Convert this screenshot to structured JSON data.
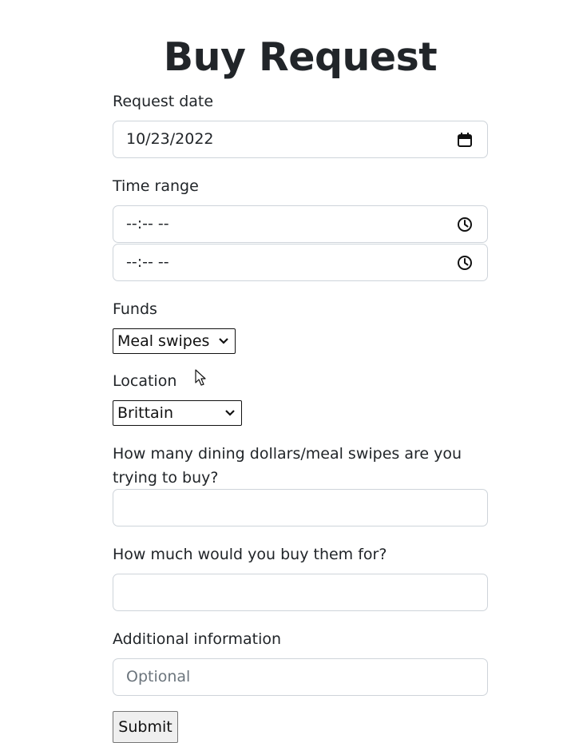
{
  "page": {
    "title": "Buy Request"
  },
  "form": {
    "request_date_label": "Request date",
    "request_date_value": "10/23/2022",
    "time_range_label": "Time range",
    "time_start_value": "--:-- --",
    "time_end_value": "--:-- --",
    "funds_label": "Funds",
    "funds_selected": "Meal swipes",
    "location_label": "Location",
    "location_selected": "Brittain",
    "quantity_label": "How many dining dollars/meal swipes are you trying to buy?",
    "quantity_value": "",
    "price_label": "How much would you buy them for?",
    "price_value": "",
    "additional_label": "Additional information",
    "additional_placeholder": "Optional",
    "submit_label": "Submit"
  },
  "icons": {
    "calendar": "calendar-icon",
    "clock": "clock-icon",
    "chevron": "chevron-down-icon",
    "cursor": "mouse-pointer-icon"
  }
}
